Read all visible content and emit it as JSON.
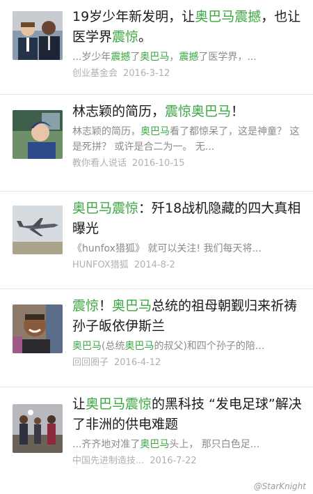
{
  "colors": {
    "highlight": "#3aa640",
    "title": "#1a1a1a",
    "snippet": "#8a8a8a",
    "meta": "#b0b0b0"
  },
  "results": [
    {
      "title_segments": [
        {
          "text": "19岁少年新发明，让",
          "hl": false
        },
        {
          "text": "奥巴马震撼",
          "hl": true
        },
        {
          "text": "，也让医学界",
          "hl": false
        },
        {
          "text": "震惊",
          "hl": true
        },
        {
          "text": "。",
          "hl": false
        }
      ],
      "snippet_segments": [
        {
          "text": "...岁少年",
          "hl": false
        },
        {
          "text": "震撼",
          "hl": true
        },
        {
          "text": "了",
          "hl": false
        },
        {
          "text": "奥巴马",
          "hl": true
        },
        {
          "text": "，",
          "hl": false
        },
        {
          "text": "震撼",
          "hl": true
        },
        {
          "text": "了医学界，...",
          "hl": false
        }
      ],
      "source": "创业基金会",
      "date": "2016-3-12",
      "thumb_icon": "photo-two-men-icon"
    },
    {
      "title_segments": [
        {
          "text": "林志颖的简历，",
          "hl": false
        },
        {
          "text": "震惊奥巴马",
          "hl": true
        },
        {
          "text": "！",
          "hl": false
        }
      ],
      "snippet_segments": [
        {
          "text": "林志颖的简历，",
          "hl": false
        },
        {
          "text": "奥巴马",
          "hl": true
        },
        {
          "text": "看了都惊呆了，这是神童？ 这是死拼？ 或许是合二为一。 无...",
          "hl": false
        }
      ],
      "source": "教你看人说话",
      "date": "2016-10-15",
      "thumb_icon": "photo-portrait-icon"
    },
    {
      "title_segments": [
        {
          "text": "奥巴马震惊",
          "hl": true
        },
        {
          "text": "：歼18战机隐藏的四大真相曝光",
          "hl": false
        }
      ],
      "snippet_segments": [
        {
          "text": "《hunfox猎狐》 就可以关注! 我们每天将...",
          "hl": false
        }
      ],
      "source": "HUNFOX猎狐",
      "date": "2014-8-2",
      "thumb_icon": "photo-fighter-jet-icon"
    },
    {
      "title_segments": [
        {
          "text": "震惊",
          "hl": true
        },
        {
          "text": "！",
          "hl": false
        },
        {
          "text": "奥巴马",
          "hl": true
        },
        {
          "text": "总统的祖母朝觐归来祈祷孙子皈依伊斯兰",
          "hl": false
        }
      ],
      "snippet_segments": [
        {
          "text": "奥巴马",
          "hl": true
        },
        {
          "text": "(总统",
          "hl": false
        },
        {
          "text": "奥巴马",
          "hl": true
        },
        {
          "text": "的叔父)和四个孙子的陪...",
          "hl": false
        }
      ],
      "source": "回回圈子",
      "date": "2016-4-12",
      "thumb_icon": "photo-smiling-man-icon"
    },
    {
      "title_segments": [
        {
          "text": "让",
          "hl": false
        },
        {
          "text": "奥巴马震惊",
          "hl": true
        },
        {
          "text": "的黑科技 “发电足球”解决了非洲的供电难题",
          "hl": false
        }
      ],
      "snippet_segments": [
        {
          "text": "...齐齐地对准了",
          "hl": false
        },
        {
          "text": "奥巴马",
          "hl": true
        },
        {
          "text": "头上， 那只白色足...",
          "hl": false
        }
      ],
      "source": "中国先进制造技...",
      "date": "2016-7-22",
      "thumb_icon": "photo-group-event-icon"
    }
  ],
  "watermark": "@StarKnight"
}
